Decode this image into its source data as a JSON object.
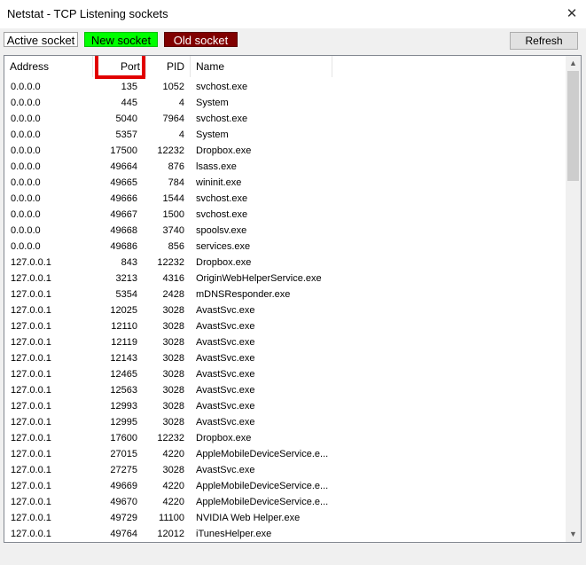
{
  "window": {
    "title": "Netstat - TCP Listening sockets",
    "close_glyph": "✕"
  },
  "legend": {
    "active": "Active socket",
    "new": "New socket",
    "old": "Old socket"
  },
  "toolbar": {
    "refresh_label": "Refresh"
  },
  "colors": {
    "new_socket": "#00ff00",
    "old_socket": "#800000",
    "highlight": "#e10000"
  },
  "table": {
    "columns": [
      "Address",
      "Port",
      "PID",
      "Name"
    ],
    "rows": [
      [
        "0.0.0.0",
        "135",
        "1052",
        "svchost.exe"
      ],
      [
        "0.0.0.0",
        "445",
        "4",
        "System"
      ],
      [
        "0.0.0.0",
        "5040",
        "7964",
        "svchost.exe"
      ],
      [
        "0.0.0.0",
        "5357",
        "4",
        "System"
      ],
      [
        "0.0.0.0",
        "17500",
        "12232",
        "Dropbox.exe"
      ],
      [
        "0.0.0.0",
        "49664",
        "876",
        "lsass.exe"
      ],
      [
        "0.0.0.0",
        "49665",
        "784",
        "wininit.exe"
      ],
      [
        "0.0.0.0",
        "49666",
        "1544",
        "svchost.exe"
      ],
      [
        "0.0.0.0",
        "49667",
        "1500",
        "svchost.exe"
      ],
      [
        "0.0.0.0",
        "49668",
        "3740",
        "spoolsv.exe"
      ],
      [
        "0.0.0.0",
        "49686",
        "856",
        "services.exe"
      ],
      [
        "127.0.0.1",
        "843",
        "12232",
        "Dropbox.exe"
      ],
      [
        "127.0.0.1",
        "3213",
        "4316",
        "OriginWebHelperService.exe"
      ],
      [
        "127.0.0.1",
        "5354",
        "2428",
        "mDNSResponder.exe"
      ],
      [
        "127.0.0.1",
        "12025",
        "3028",
        "AvastSvc.exe"
      ],
      [
        "127.0.0.1",
        "12110",
        "3028",
        "AvastSvc.exe"
      ],
      [
        "127.0.0.1",
        "12119",
        "3028",
        "AvastSvc.exe"
      ],
      [
        "127.0.0.1",
        "12143",
        "3028",
        "AvastSvc.exe"
      ],
      [
        "127.0.0.1",
        "12465",
        "3028",
        "AvastSvc.exe"
      ],
      [
        "127.0.0.1",
        "12563",
        "3028",
        "AvastSvc.exe"
      ],
      [
        "127.0.0.1",
        "12993",
        "3028",
        "AvastSvc.exe"
      ],
      [
        "127.0.0.1",
        "12995",
        "3028",
        "AvastSvc.exe"
      ],
      [
        "127.0.0.1",
        "17600",
        "12232",
        "Dropbox.exe"
      ],
      [
        "127.0.0.1",
        "27015",
        "4220",
        "AppleMobileDeviceService.e..."
      ],
      [
        "127.0.0.1",
        "27275",
        "3028",
        "AvastSvc.exe"
      ],
      [
        "127.0.0.1",
        "49669",
        "4220",
        "AppleMobileDeviceService.e..."
      ],
      [
        "127.0.0.1",
        "49670",
        "4220",
        "AppleMobileDeviceService.e..."
      ],
      [
        "127.0.0.1",
        "49729",
        "11100",
        "NVIDIA Web Helper.exe"
      ],
      [
        "127.0.0.1",
        "49764",
        "12012",
        "iTunesHelper.exe"
      ]
    ]
  },
  "scrollbar": {
    "up_icon": "chevron-up-icon",
    "down_icon": "chevron-down-icon"
  }
}
